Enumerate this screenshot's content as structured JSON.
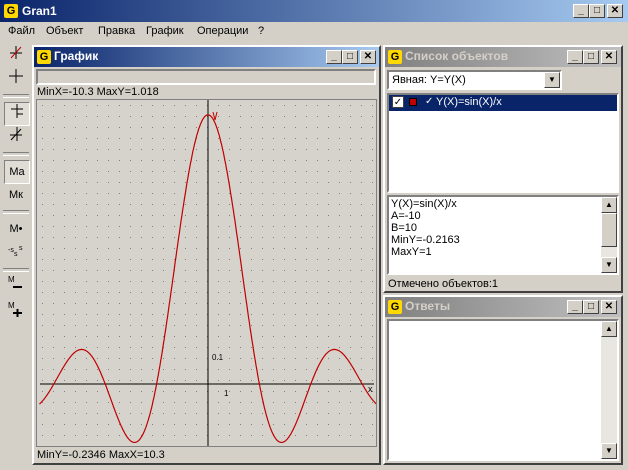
{
  "app": {
    "title": "Gran1",
    "icon_letter": "G"
  },
  "window_buttons": {
    "minimize": "_",
    "maximize": "□",
    "close": "✕"
  },
  "menu": [
    "Файл",
    "Объект",
    "Правка",
    "График",
    "Операции",
    "?"
  ],
  "toolbar": {
    "tools": [
      "draw-line-icon",
      "crosshair-icon",
      "coord-axes-icon",
      "tangent-icon",
      "Ma",
      "Mк",
      "M•",
      "scale-icon",
      "zoom-out-icon",
      "zoom-in-icon"
    ],
    "labels": {
      "ma": "Ma",
      "mk": "Mк",
      "mpoint": "M•",
      "mminus": "M",
      "mplus": "M",
      "scale": "s"
    }
  },
  "graph_window": {
    "title": "График",
    "top_status": "MinX=-10.3  MaxY=1.018",
    "bottom_status": "MinY=-0.2346  MaxX=10.3",
    "axis_x_label": "x",
    "tick_y": "0.1",
    "tick_x": "1"
  },
  "chart_data": {
    "type": "line",
    "function": "Y(X)=sin(X)/x",
    "xlim": [
      -10.3,
      10.3
    ],
    "ylim": [
      -0.2346,
      1.018
    ],
    "line_color": "#c00000",
    "grid": true
  },
  "objects_window": {
    "title": "Список объектов",
    "combo_value": "Явная: Y=Y(X)",
    "items": [
      {
        "checked": true,
        "label": "Y(X)=sin(X)/x",
        "selected": true
      }
    ],
    "details": [
      "Y(X)=sin(X)/x",
      "A=-10",
      "B=10",
      "MinY=-0.2163",
      "MaxY=1"
    ],
    "status": "Отмечено объектов:1"
  },
  "answers_window": {
    "title": "Ответы"
  }
}
